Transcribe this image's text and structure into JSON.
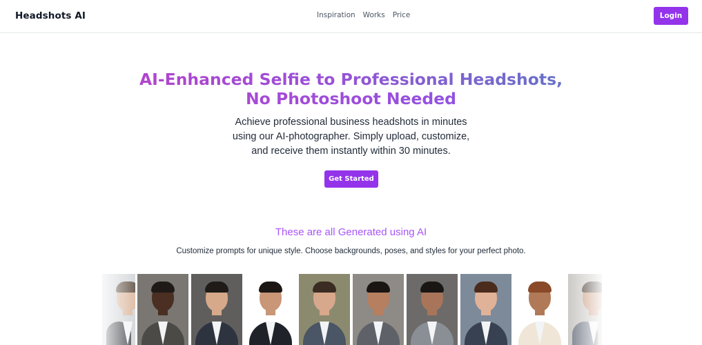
{
  "header": {
    "brand": "Headshots AI",
    "nav": [
      "Inspiration",
      "Works",
      "Price"
    ],
    "login_label": "Login"
  },
  "hero": {
    "title_line1": "AI-Enhanced Selfie to Professional Headshots,",
    "title_line2": "No Photoshoot Needed",
    "subtitle_lines": [
      "Achieve professional business headshots in minutes",
      "using our AI-photographer. Simply upload, customize,",
      "and receive them instantly within 30 minutes."
    ],
    "cta_label": "Get Started"
  },
  "gallery": {
    "title": "These are all Generated using AI",
    "subtitle": "Customize prompts for unique style. Choose backgrounds, poses, and styles for your perfect photo."
  },
  "colors": {
    "accent": "#9333ea",
    "gallery_title": "#a855f7"
  }
}
